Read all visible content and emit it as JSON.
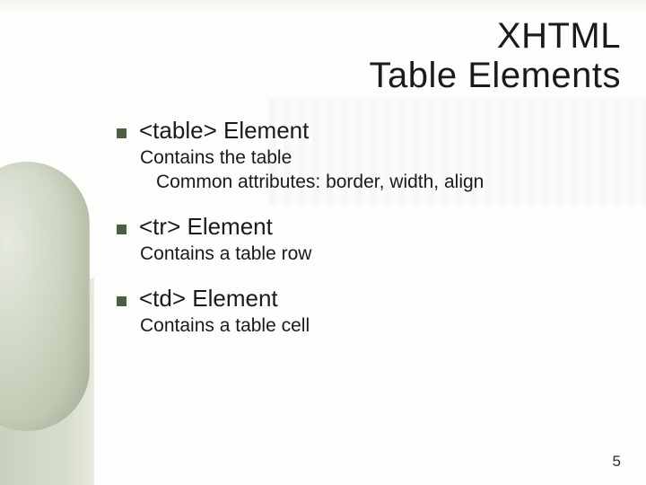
{
  "title": {
    "line1": "XHTML",
    "line2": "Table Elements"
  },
  "items": [
    {
      "title": "<table> Element",
      "desc1": "Contains the table",
      "desc2": "Common attributes: border, width, align"
    },
    {
      "title": "<tr> Element",
      "desc1": "Contains a table row",
      "desc2": ""
    },
    {
      "title": "<td> Element",
      "desc1": "Contains a table cell",
      "desc2": ""
    }
  ],
  "page_number": "5"
}
